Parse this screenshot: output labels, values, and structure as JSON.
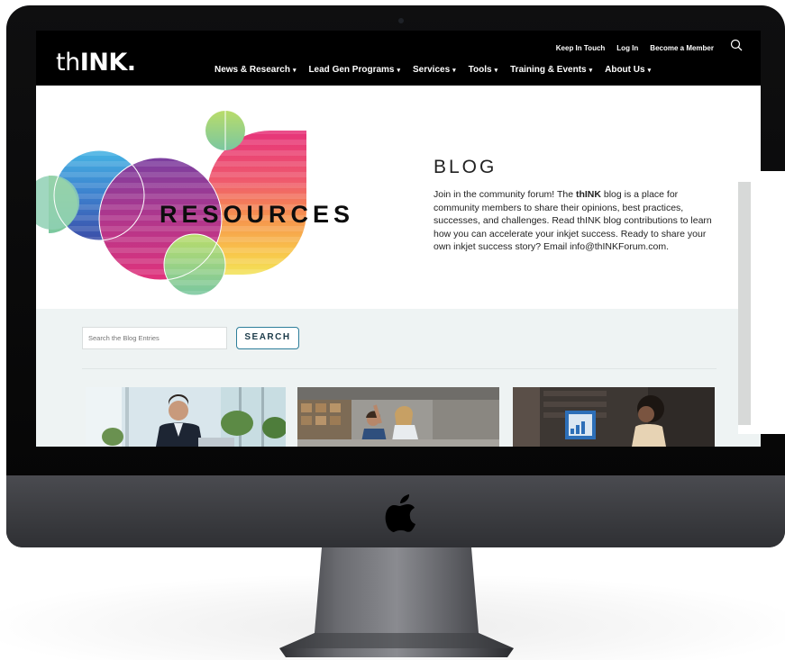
{
  "header": {
    "logo_thin": "th",
    "logo_bold": "INK.",
    "utility_links": [
      "Keep In Touch",
      "Log In",
      "Become a Member"
    ],
    "nav": [
      {
        "label": "News & Research"
      },
      {
        "label": "Lead Gen Programs"
      },
      {
        "label": "Services"
      },
      {
        "label": "Tools"
      },
      {
        "label": "Training & Events"
      },
      {
        "label": "About Us"
      }
    ]
  },
  "hero": {
    "graphic_word": "RESOURCES",
    "title": "BLOG",
    "intro_before": "Join in the community forum! The ",
    "intro_bold": "thINK",
    "intro_after": " blog is a place for community members to share their opinions, best practices, successes, and challenges. Read thINK blog contributions to learn how you can accelerate your inkjet success. Ready to share your own inkjet success story? Email info@thINKForum.com."
  },
  "search": {
    "placeholder": "Search the Blog Entries",
    "button_label": "SEARCH"
  },
  "icons": {
    "search": "search-icon",
    "caret": "caret-down-icon",
    "brand": "apple-icon"
  },
  "colors": {
    "header_bg": "#000000",
    "search_band_bg": "#eef3f3",
    "button_border": "#2d7e9a"
  }
}
